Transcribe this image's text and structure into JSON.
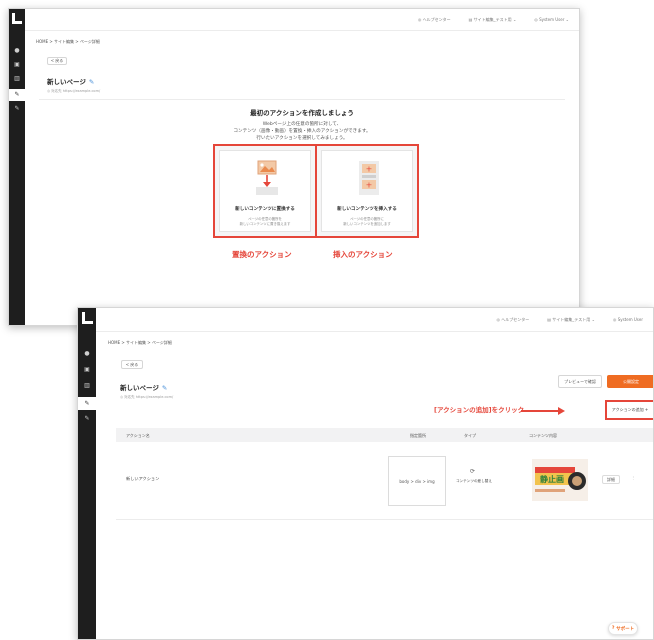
{
  "screen1": {
    "header": {
      "help_center": "ヘルプセンター",
      "site_menu": "サイト編集_テスト用",
      "user_menu": "System User"
    },
    "breadcrumb": "HOME > サイト編集 > ページ詳細",
    "back_label": "< 戻る",
    "page_title": "新しいページ",
    "page_url": "https://example.com/",
    "empty_state": {
      "heading": "最初のアクションを作成しましょう",
      "desc_line1": "Webページ上の任意の箇所に対して、",
      "desc_line2": "コンテンツ（画像・動画）を置換・挿入のアクションができます。",
      "desc_line3": "行いたいアクションを選択してみましょう。"
    },
    "options": [
      {
        "title": "新しいコンテンツに置換する",
        "desc_line1": "ページの任意の箇所を",
        "desc_line2": "新しいコンテンツに置き換えます",
        "callout": "置換のアクション"
      },
      {
        "title": "新しいコンテンツを挿入する",
        "desc_line1": "ページの任意の箇所に",
        "desc_line2": "新しいコンテンツを追加します",
        "callout": "挿入のアクション"
      }
    ]
  },
  "screen2": {
    "header": {
      "help_center": "ヘルプセンター",
      "site_menu": "サイト編集_テスト用",
      "user_menu": "System User"
    },
    "breadcrumb": "HOME > サイト編集 > ページ詳細",
    "back_label": "< 戻る",
    "page_title": "新しいページ",
    "page_url": "https://example.com/",
    "preview_button": "プレビューで確認",
    "publish_button": "公開設定",
    "add_action_button": "アクションの追加 +",
    "add_callout": "[アクションの追加]をクリック",
    "table": {
      "headers": [
        "アクション名",
        "指定箇所",
        "タイプ",
        "コンテンツ内容"
      ],
      "rows": [
        {
          "name": "新しいアクション",
          "selector": "body > div > img",
          "type": "コンテンツの差し替え",
          "detail": "詳細"
        }
      ]
    },
    "banner_text": "静止画",
    "support_button": "サポート"
  },
  "colors": {
    "accent_red": "#e5463a",
    "brand_orange": "#ef6c22",
    "rail_dark": "#1e1e1e"
  }
}
